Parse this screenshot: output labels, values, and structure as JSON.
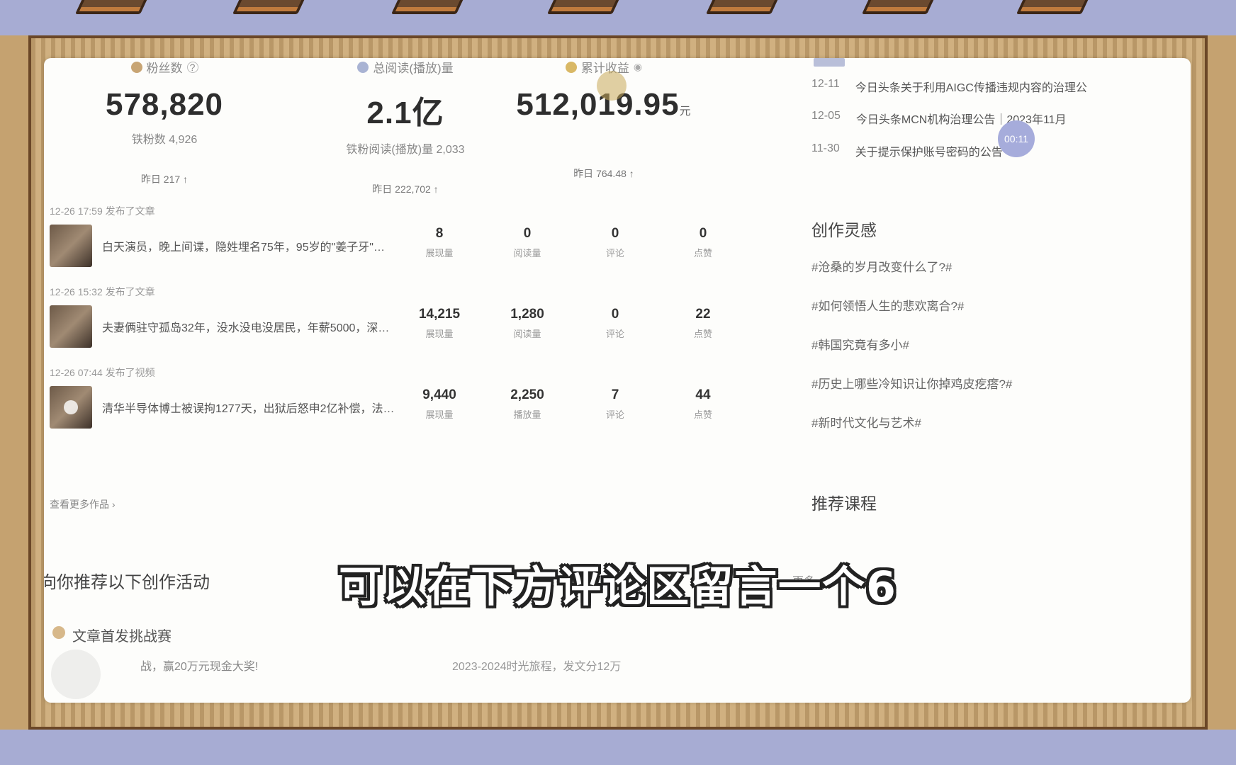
{
  "stats": [
    {
      "label": "粉丝数",
      "icon": "user-icon",
      "value": "578,820",
      "unit": "",
      "sub": "铁粉数 4,926",
      "yesterday": "昨日  217 ↑"
    },
    {
      "label": "总阅读(播放)量",
      "icon": "read-icon",
      "value": "2.1亿",
      "unit": "",
      "sub": "铁粉阅读(播放)量 2,033",
      "yesterday": "昨日  222,702 ↑"
    },
    {
      "label": "累计收益",
      "icon": "coin-icon",
      "value": "512,019.95",
      "unit": "元",
      "sub": "",
      "yesterday": "昨日  764.48 ↑"
    }
  ],
  "feed": [
    {
      "meta": "12-26 17:59   发布了文章",
      "title": "白天演员，晚上间谍，隐姓埋名75年，95岁的\"姜子牙\"…",
      "metrics": [
        {
          "num": "8",
          "lbl": "展现量"
        },
        {
          "num": "0",
          "lbl": "阅读量"
        },
        {
          "num": "0",
          "lbl": "评论"
        },
        {
          "num": "0",
          "lbl": "点赞"
        }
      ]
    },
    {
      "meta": "12-26 15:32   发布了文章",
      "title": "夫妻俩驻守孤岛32年，没水没电没居民，年薪5000，深…",
      "metrics": [
        {
          "num": "14,215",
          "lbl": "展现量"
        },
        {
          "num": "1,280",
          "lbl": "阅读量"
        },
        {
          "num": "0",
          "lbl": "评论"
        },
        {
          "num": "22",
          "lbl": "点赞"
        }
      ]
    },
    {
      "meta": "12-26 07:44   发布了视频",
      "title": "清华半导体博士被误拘1277天，出狱后怒申2亿补偿，法…",
      "metrics": [
        {
          "num": "9,440",
          "lbl": "展现量"
        },
        {
          "num": "2,250",
          "lbl": "播放量"
        },
        {
          "num": "7",
          "lbl": "评论"
        },
        {
          "num": "44",
          "lbl": "点赞"
        }
      ]
    }
  ],
  "more_works": "查看更多作品 ›",
  "recommend": {
    "title": "向你推荐以下创作活动",
    "more": "更多 ›",
    "activity_title": "文章首发挑战赛",
    "activity_desc": "战，赢20万元现金大奖!",
    "activity_desc2": "2023-2024时光旅程，发文分12万"
  },
  "notices": [
    {
      "date": "12-11",
      "text": "今日头条关于利用AIGC传播违规内容的治理公"
    },
    {
      "date": "12-05",
      "text": "今日头条MCN机构治理公告｜2023年11月"
    },
    {
      "date": "11-30",
      "text": "关于提示保护账号密码的公告"
    }
  ],
  "inspiration": {
    "title": "创作灵感",
    "topics": [
      "#沧桑的岁月改变什么了?#",
      "#如何领悟人生的悲欢离合?#",
      "#韩国究竟有多小#",
      "#历史上哪些冷知识让你掉鸡皮疙瘩?#",
      "#新时代文化与艺术#"
    ]
  },
  "courses_title": "推荐课程",
  "timer": "00:11",
  "subtitle": "可以在下方评论区留言一个6",
  "colors": {
    "background": "#a7acd3",
    "frame": "#c9a977",
    "panel": "#fdfdfb",
    "timer": "#a6acdb"
  }
}
